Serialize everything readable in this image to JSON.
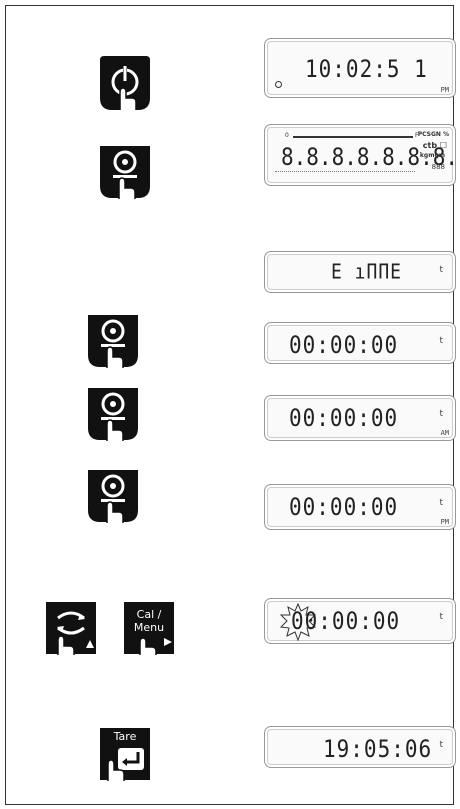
{
  "buttons": {
    "power": {
      "icon": "power-icon"
    },
    "print": {
      "icon": "print-icon"
    },
    "mode": {
      "icon": "mode-icon"
    },
    "cal_menu": {
      "label_line1": "Cal /",
      "label_line2": "Menu",
      "arrow": "▶"
    },
    "tare": {
      "label": "Tare"
    }
  },
  "displays": {
    "clock_ampm": {
      "digits": "10:02:5 1",
      "ampm": "PM"
    },
    "full_segments": {
      "digits": "8.8.8.8.8.8.8.8.",
      "top_left": "0",
      "top_right": "F",
      "right_top": "PCSGN %",
      "right_mid": "ctb ☐",
      "right_low": "kgmgm",
      "icons": "888"
    },
    "time_label": {
      "text": "E ıΠΠΕ",
      "unit": "t"
    },
    "zero_1": {
      "digits": "00:00:00",
      "unit": "t"
    },
    "zero_am": {
      "digits": "00:00:00",
      "unit": "t",
      "ampm": "AM"
    },
    "zero_pm": {
      "digits": "00:00:00",
      "unit": "t",
      "ampm": "PM"
    },
    "zero_flash": {
      "digits": "00:00:00",
      "unit": "t"
    },
    "final_time": {
      "digits": "19:05:06",
      "unit": "t"
    }
  }
}
